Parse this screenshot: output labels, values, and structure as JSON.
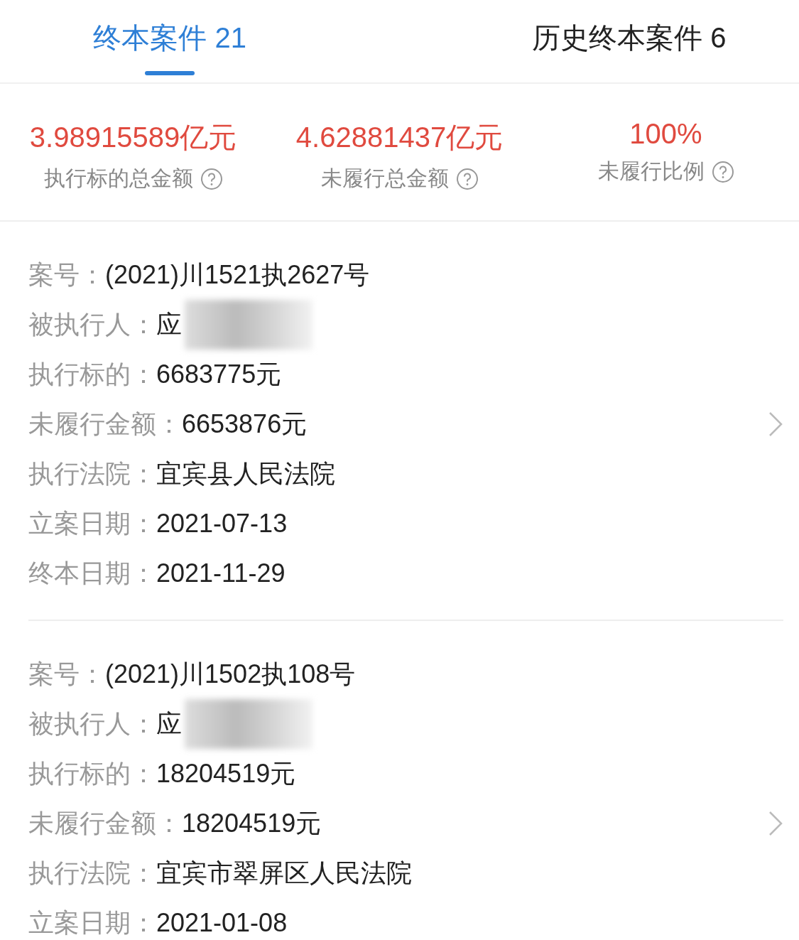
{
  "tabs": [
    {
      "label": "终本案件 21",
      "selected": true
    },
    {
      "label": "历史终本案件 6",
      "selected": false
    }
  ],
  "summary": [
    {
      "value": "3.98915589亿元",
      "label": "执行标的总金额"
    },
    {
      "value": "4.62881437亿元",
      "label": "未履行总金额"
    },
    {
      "value": "100%",
      "label": "未履行比例"
    }
  ],
  "cases": [
    {
      "rows": [
        {
          "label": "案号：",
          "value": "(2021)川1521执2627号"
        },
        {
          "label": "被执行人：",
          "value": "应",
          "redacted": true
        },
        {
          "label": "执行标的：",
          "value": "6683775元"
        },
        {
          "label": "未履行金额：",
          "value": "6653876元",
          "chevron": true
        },
        {
          "label": "执行法院：",
          "value": "宜宾县人民法院"
        },
        {
          "label": "立案日期：",
          "value": "2021-07-13"
        },
        {
          "label": "终本日期：",
          "value": "2021-11-29"
        }
      ]
    },
    {
      "rows": [
        {
          "label": "案号：",
          "value": "(2021)川1502执108号"
        },
        {
          "label": "被执行人：",
          "value": "应",
          "redacted": true
        },
        {
          "label": "执行标的：",
          "value": "18204519元"
        },
        {
          "label": "未履行金额：",
          "value": "18204519元",
          "chevron": true
        },
        {
          "label": "执行法院：",
          "value": "宜宾市翠屏区人民法院"
        },
        {
          "label": "立案日期：",
          "value": "2021-01-08"
        }
      ]
    }
  ]
}
